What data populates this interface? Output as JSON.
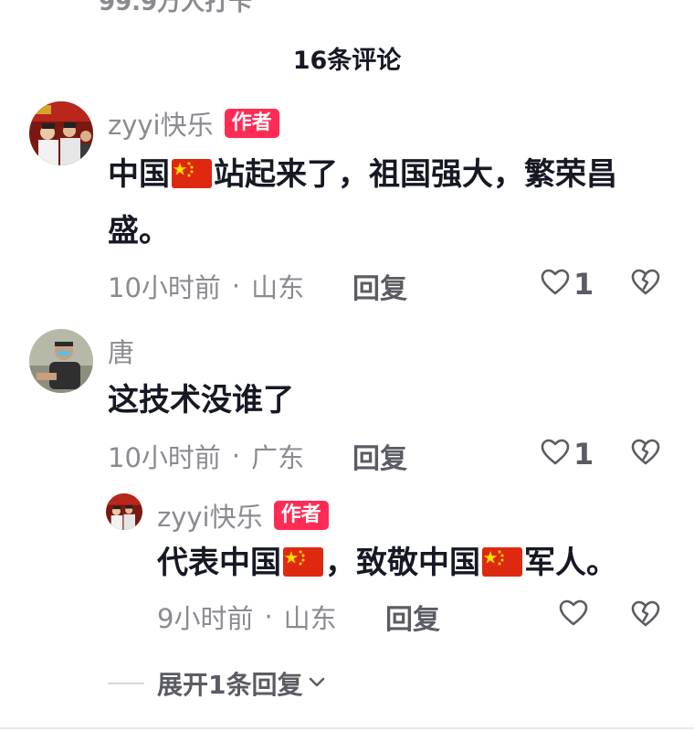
{
  "header": {
    "clipped_text": "99.9万人打卡",
    "comment_count": "16条评论"
  },
  "colors": {
    "author_badge": "#fe2c55",
    "secondary_text": "#8a8b91",
    "primary_text": "#161823"
  },
  "comments": [
    {
      "username": "zyyi快乐",
      "badge": "作者",
      "text_part1": "中国",
      "flag1": "china-flag-icon",
      "text_part2": "站起来了，祖国强大，繁荣昌",
      "text_line2": "盛。",
      "time": "10小时前",
      "dot": "·",
      "location": "山东",
      "reply": "回复",
      "likes": "1"
    },
    {
      "username": "唐",
      "text": "这技术没谁了",
      "time": "10小时前",
      "dot": "·",
      "location": "广东",
      "reply": "回复",
      "likes": "1"
    }
  ],
  "reply": {
    "username": "zyyi快乐",
    "badge": "作者",
    "text_part1": "代表中国",
    "text_part2": "，致敬中国",
    "text_part3": "军人。",
    "time": "9小时前",
    "dot": "·",
    "location": "山东",
    "reply": "回复"
  },
  "expand": {
    "label": "展开1条回复"
  }
}
